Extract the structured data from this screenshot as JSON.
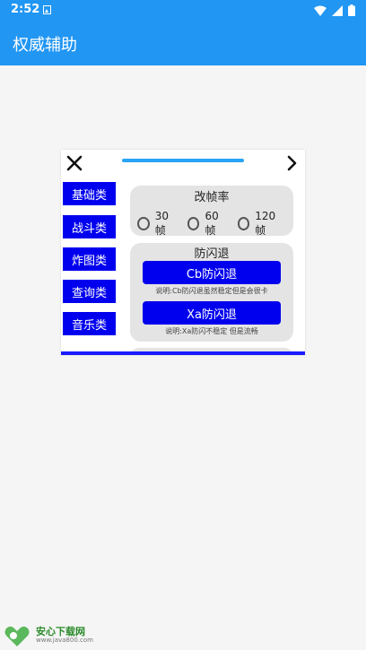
{
  "status": {
    "time": "2:52"
  },
  "app": {
    "title": "权威辅助"
  },
  "sidebar": {
    "items": [
      {
        "label": "基础类"
      },
      {
        "label": "战斗类"
      },
      {
        "label": "炸图类"
      },
      {
        "label": "查询类"
      },
      {
        "label": "音乐类"
      }
    ]
  },
  "fps_card": {
    "title": "改帧率",
    "options": [
      {
        "label": "30帧"
      },
      {
        "label": "60帧"
      },
      {
        "label": "120帧"
      }
    ]
  },
  "flash_card": {
    "title": "防闪退",
    "buttons": [
      {
        "label": "Cb防闪退",
        "note": "说明:Cb防闪退虽然稳定但是会很卡"
      },
      {
        "label": "Xa防闪退",
        "note": "说明:Xa防闪不稳定 但是流畅"
      }
    ]
  },
  "colors": {
    "primary": "#2196f3",
    "button": "#0000ee",
    "card": "#e4e4e4"
  },
  "watermark": {
    "name": "安心下载网",
    "url": "www.java800.com"
  }
}
